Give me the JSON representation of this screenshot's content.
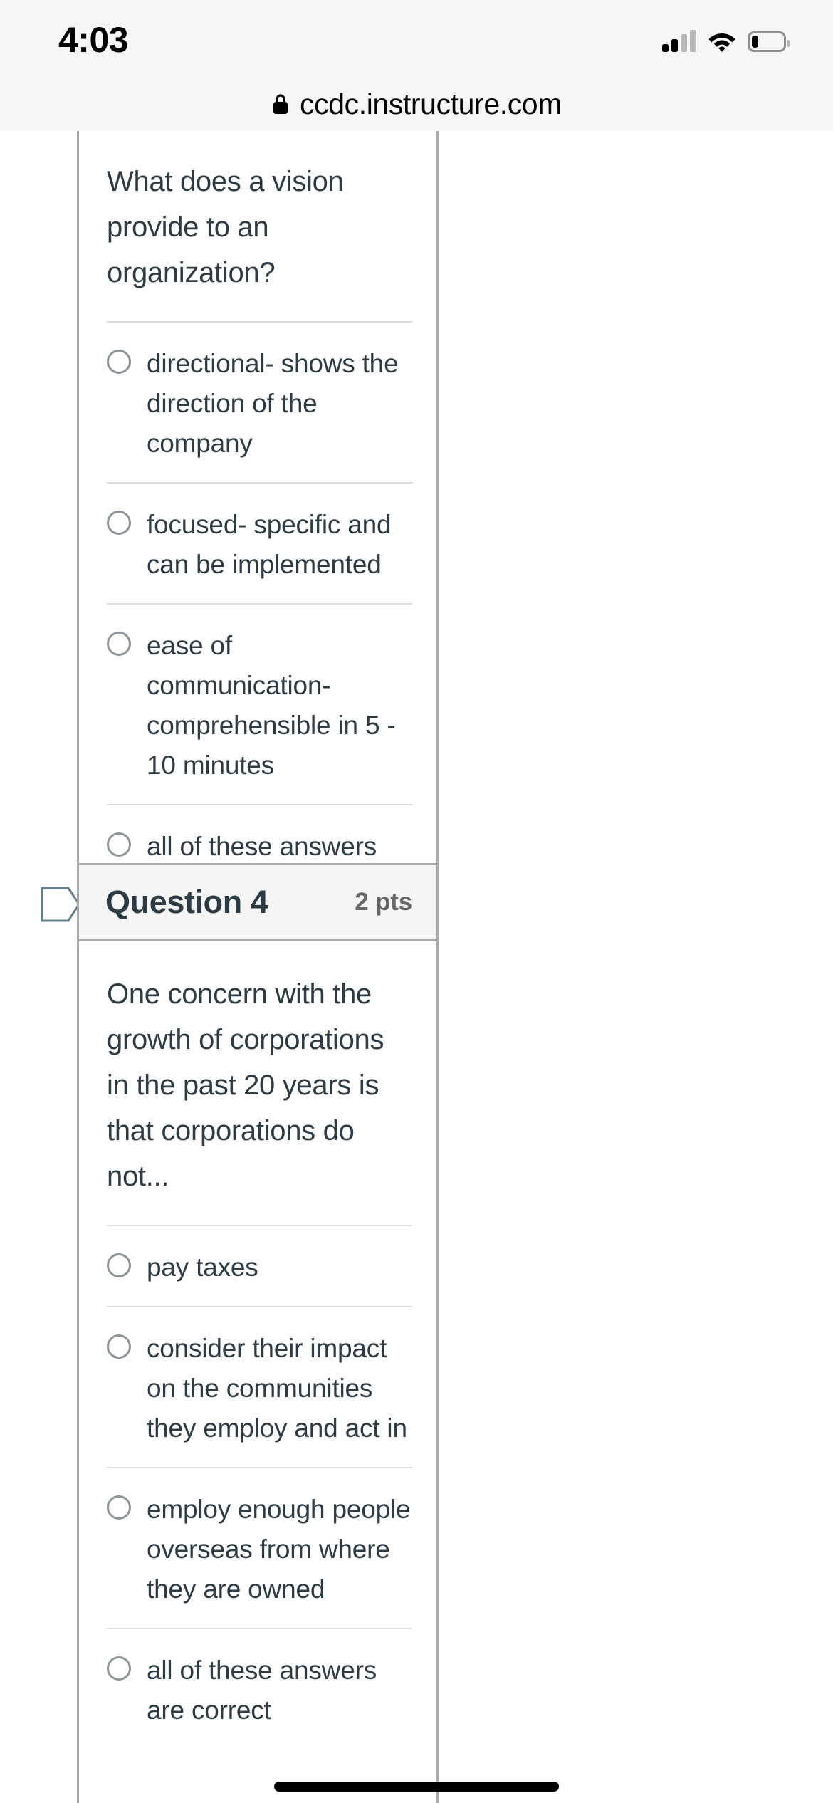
{
  "status_bar": {
    "time": "4:03",
    "icons": [
      "cellular-signal-icon",
      "wifi-icon",
      "battery-icon"
    ]
  },
  "browser": {
    "lock_icon": "lock-icon",
    "url": "ccdc.instructure.com"
  },
  "questions": [
    {
      "header_visible": false,
      "title": "",
      "points": "",
      "text": "What does a vision provide to an organization?",
      "answers": [
        "directional- shows the direction of the company",
        "focused- specific and can be implemented",
        "ease of communication- comprehensible in 5 - 10 minutes",
        "all of these answers are correct"
      ]
    },
    {
      "header_visible": true,
      "title": "Question 4",
      "points": "2 pts",
      "flag_icon": "flag-marker-icon",
      "text": "One concern with the growth of corporations in the past 20 years is that corporations do not...",
      "answers": [
        "pay taxes",
        "consider their impact on the communities they employ and act in",
        "employ enough people overseas from where they are owned",
        "all of these answers are correct"
      ]
    }
  ],
  "home_indicator": "home-indicator",
  "colors": {
    "text": "#2d3b45",
    "border": "#a9acaf",
    "divider": "#dddddd",
    "header_bg": "#f5f5f5",
    "points_text": "#676767",
    "flag_stroke": "#66808f"
  }
}
